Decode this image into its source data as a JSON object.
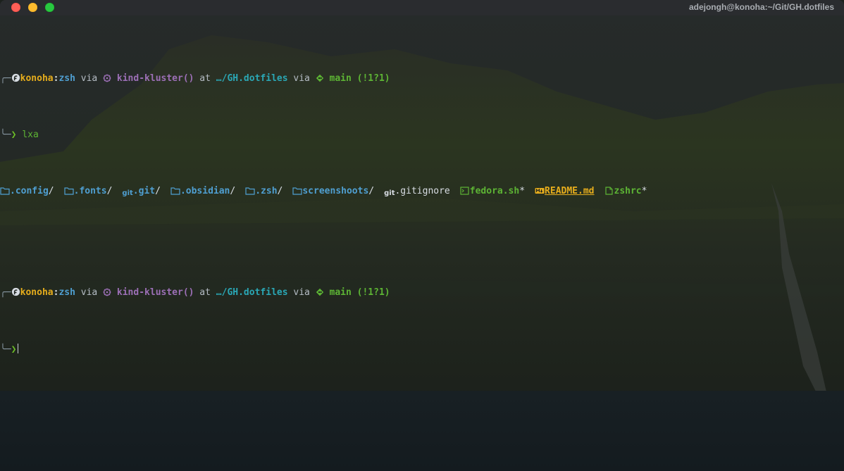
{
  "window": {
    "title": "adejongh@konoha:~/Git/GH.dotfiles"
  },
  "prompt": {
    "host": "konoha",
    "sep": ":",
    "shell": "zsh",
    "via1": " via ",
    "k8s_context": "kind-kluster()",
    "at": " at ",
    "path": "…/GH.dotfiles",
    "via2": " via ",
    "branch": "main",
    "status": " (!1?1)",
    "arrow": "❯"
  },
  "command": "lxa",
  "listing": [
    {
      "name": ".config",
      "suffix": "/",
      "icon": "folder-icon",
      "color": "#4f9fd1"
    },
    {
      "name": ".fonts",
      "suffix": "/",
      "icon": "folder-icon",
      "color": "#4f9fd1"
    },
    {
      "name": ".git",
      "suffix": "/",
      "icon": "git-icon",
      "icon_text": "git",
      "color": "#4f9fd1"
    },
    {
      "name": ".obsidian",
      "suffix": "/",
      "icon": "folder-icon",
      "color": "#4f9fd1"
    },
    {
      "name": ".zsh",
      "suffix": "/",
      "icon": "folder-icon",
      "color": "#4f9fd1"
    },
    {
      "name": "screenshoots",
      "suffix": "/",
      "icon": "folder-icon",
      "color": "#4f9fd1"
    },
    {
      "name": ".gitignore",
      "suffix": "",
      "icon": "git-icon",
      "icon_text": "git",
      "color": "#d8dde3"
    },
    {
      "name": "fedora.sh",
      "suffix": "*",
      "icon": "terminal-icon",
      "color": "#5db434"
    },
    {
      "name": "README.md",
      "suffix": "",
      "icon": "markdown-icon",
      "color": "#e6ad1c"
    },
    {
      "name": "zshrc",
      "suffix": "*",
      "icon": "file-icon",
      "color": "#5db434"
    }
  ],
  "colors": {
    "titlebar": "#2a2c2f",
    "background": "#1c211d",
    "host": "#e6ad1c",
    "shell": "#4f9fd1",
    "k8s": "#9c6fb6",
    "path": "#2aa7b5",
    "git": "#5db434"
  }
}
